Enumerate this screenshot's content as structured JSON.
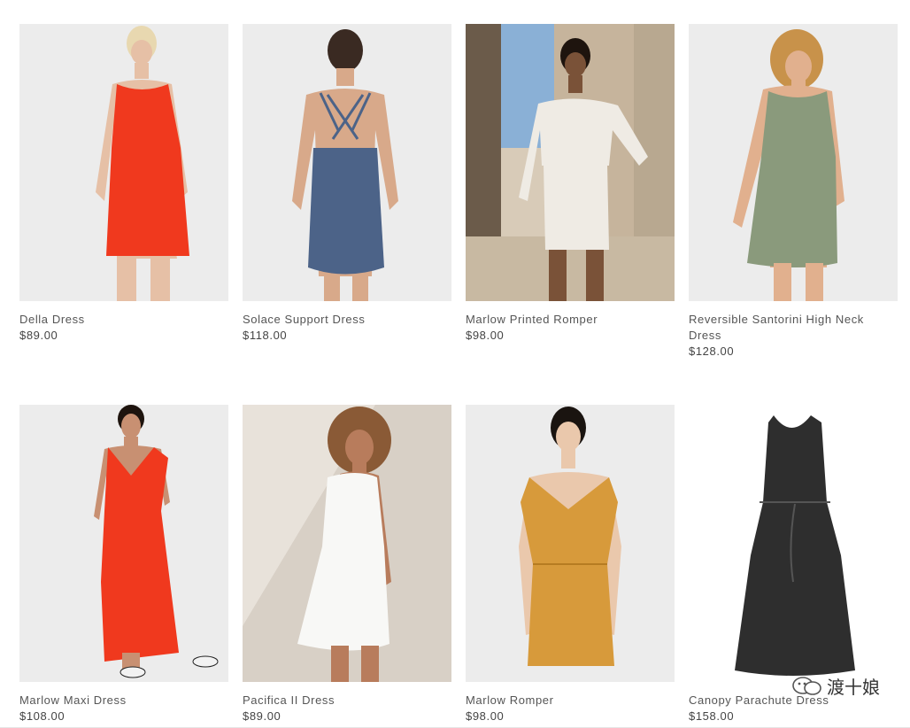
{
  "products": [
    {
      "name": "Della Dress",
      "price": "$89.00",
      "color": "#f0391e",
      "bg": "#ececec",
      "style": "tank-mini"
    },
    {
      "name": "Solace Support Dress",
      "price": "$118.00",
      "color": "#4c6388",
      "bg": "#ececec",
      "style": "strappy-back"
    },
    {
      "name": "Marlow Printed Romper",
      "price": "$98.00",
      "color": "#efebe4",
      "bg": "#c9b59a",
      "style": "romper-outdoor"
    },
    {
      "name": "Reversible Santorini High Neck Dress",
      "price": "$128.00",
      "color": "#8a9a7c",
      "bg": "#ececec",
      "style": "tank-mini"
    },
    {
      "name": "Marlow Maxi Dress",
      "price": "$108.00",
      "color": "#f0391e",
      "bg": "#ececec",
      "style": "maxi"
    },
    {
      "name": "Pacifica II Dress",
      "price": "$89.00",
      "color": "#f8f8f6",
      "bg": "#d8d0c6",
      "style": "shift"
    },
    {
      "name": "Marlow Romper",
      "price": "$98.00",
      "color": "#d79a3b",
      "bg": "#ececec",
      "style": "romper"
    },
    {
      "name": "Canopy Parachute Dress",
      "price": "$158.00",
      "color": "#2e2e2e",
      "bg": "#ffffff",
      "style": "flat-dress"
    }
  ],
  "watermark": {
    "text": "渡十娘"
  }
}
